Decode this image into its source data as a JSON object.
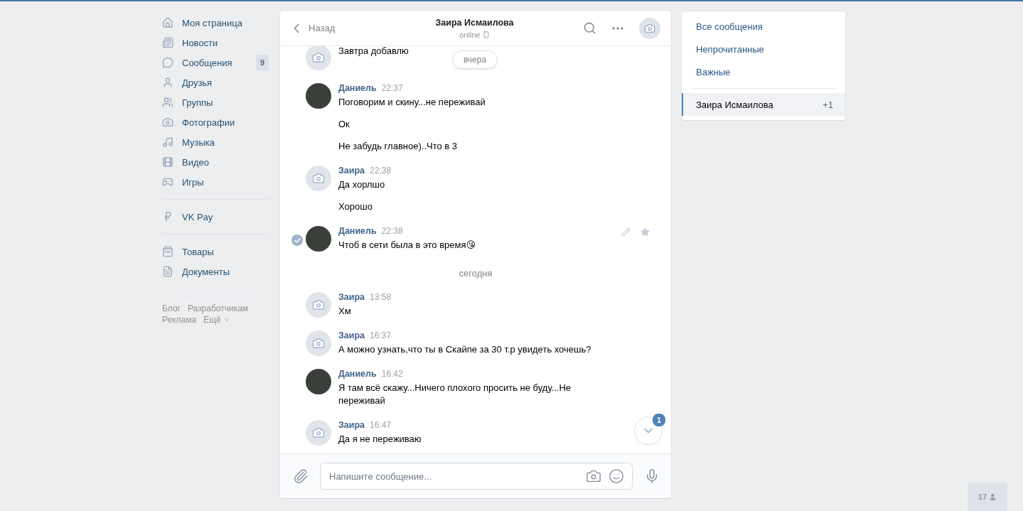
{
  "nav": {
    "sections": [
      [
        {
          "label": "Моя страница"
        },
        {
          "label": "Новости"
        },
        {
          "label": "Сообщения",
          "count": "9"
        },
        {
          "label": "Друзья"
        },
        {
          "label": "Группы"
        },
        {
          "label": "Фотографии"
        },
        {
          "label": "Музыка"
        },
        {
          "label": "Видео"
        },
        {
          "label": "Игры"
        }
      ],
      [
        {
          "label": "VK Pay"
        }
      ],
      [
        {
          "label": "Товары"
        },
        {
          "label": "Документы"
        }
      ]
    ],
    "footer_links": [
      "Блог",
      "Разработчикам",
      "Реклама",
      "Ещё"
    ]
  },
  "chat": {
    "back": "Назад",
    "title": "Заира Исмаилова",
    "status": "online",
    "floating_date": "вчера",
    "messages": [
      {
        "kind": "group",
        "has_photo": false,
        "selected": false,
        "lines": [
          "Завтра добавлю"
        ]
      },
      {
        "kind": "group",
        "has_photo": true,
        "author": "Даниель",
        "time": "22:37",
        "selected": false,
        "lines": [
          "Поговорим и скину...не переживай",
          "Ок",
          "Не забудь главное)..Что в 3"
        ]
      },
      {
        "kind": "group",
        "has_photo": false,
        "author": "Заира",
        "time": "22:38",
        "selected": false,
        "lines": [
          "Да хорлшо",
          "Хорошо"
        ]
      },
      {
        "kind": "group",
        "has_photo": true,
        "author": "Даниель",
        "time": "22:38",
        "selected": true,
        "lines": [
          "Чтоб в сети была в это время😘"
        ]
      },
      {
        "kind": "date",
        "label": "сегодня"
      },
      {
        "kind": "group",
        "has_photo": false,
        "author": "Заира",
        "time": "13:58",
        "selected": false,
        "lines": [
          "Хм"
        ]
      },
      {
        "kind": "group",
        "has_photo": false,
        "author": "Заира",
        "time": "16:37",
        "selected": false,
        "lines": [
          "А можно узнать,что ты в Скайпе за 30 т.р увидеть хочешь?"
        ]
      },
      {
        "kind": "group",
        "has_photo": true,
        "author": "Даниель",
        "time": "16:42",
        "selected": false,
        "lines": [
          "Я там всё скажу...Ничего плохого просить не буду...Не переживай"
        ]
      },
      {
        "kind": "group",
        "has_photo": false,
        "author": "Заира",
        "time": "16:47",
        "selected": false,
        "lines": [
          "Да я не переживаю"
        ]
      }
    ],
    "unread_badge": "1",
    "composer": {
      "placeholder": "Напишите сообщение..."
    }
  },
  "filters": [
    {
      "label": "Все сообщения",
      "selected": false
    },
    {
      "label": "Непрочитанные",
      "selected": false
    },
    {
      "label": "Важные",
      "selected": false
    }
  ],
  "conversations": [
    {
      "name": "Заира Исмаилова",
      "count": "+1",
      "selected": true
    }
  ],
  "online_friends": "17"
}
